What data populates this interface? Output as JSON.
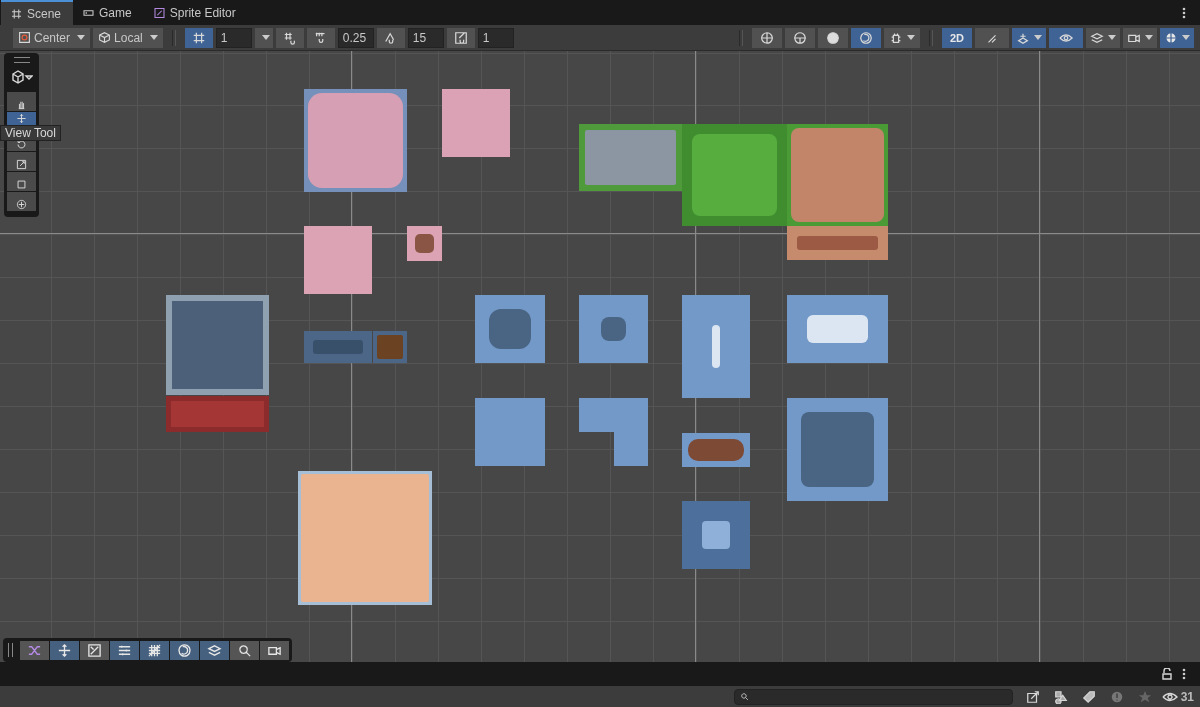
{
  "tabs": [
    {
      "label": "Scene",
      "selected": true
    },
    {
      "label": "Game",
      "selected": false
    },
    {
      "label": "Sprite Editor",
      "selected": false
    }
  ],
  "toolbar": {
    "pivot_position": "Center",
    "pivot_rotation": "Local",
    "grid": {
      "on": true,
      "value": "1"
    },
    "move_snap": "0.25",
    "rotate_snap": "15",
    "scale_snap": "1",
    "shading_modes": [
      {
        "kind": "wireframe",
        "selected": false
      },
      {
        "kind": "shaded-wireframe",
        "selected": false
      },
      {
        "kind": "shaded",
        "selected": false
      },
      {
        "kind": "unlit",
        "selected": true
      }
    ],
    "toggles": [
      {
        "kind": "dimension",
        "label": "2D",
        "on": true
      },
      {
        "kind": "lighting",
        "on": false
      },
      {
        "kind": "effects",
        "on": true
      },
      {
        "kind": "visibility",
        "on": true
      },
      {
        "kind": "layers",
        "on": false
      },
      {
        "kind": "camera",
        "on": false
      },
      {
        "kind": "gizmos",
        "on": true
      }
    ]
  },
  "tools": [
    {
      "kind": "view",
      "selected": false
    },
    {
      "kind": "move",
      "selected": true
    },
    {
      "kind": "rotate",
      "selected": false
    },
    {
      "kind": "scale",
      "selected": false
    },
    {
      "kind": "rect",
      "selected": false
    },
    {
      "kind": "transform",
      "selected": false
    }
  ],
  "tooltip": "View Tool",
  "overlays": [
    {
      "kind": "shuffle",
      "on": false
    },
    {
      "kind": "move",
      "on": true
    },
    {
      "kind": "swap",
      "on": false
    },
    {
      "kind": "sliders",
      "on": true
    },
    {
      "kind": "grid",
      "on": true
    },
    {
      "kind": "unlit",
      "on": true
    },
    {
      "kind": "layers",
      "on": true
    },
    {
      "kind": "search",
      "on": false
    },
    {
      "kind": "camera",
      "on": false
    }
  ],
  "status_bar": {
    "visible_count": "31"
  }
}
